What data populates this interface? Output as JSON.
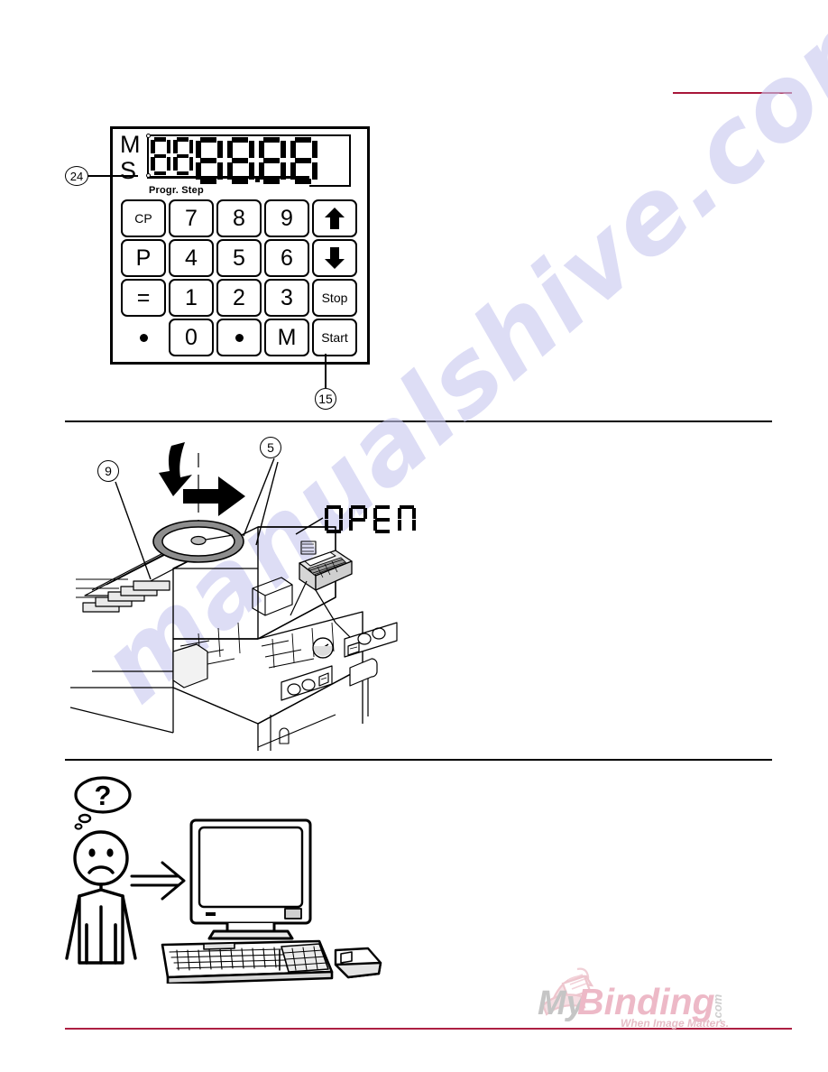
{
  "page": {
    "background": "#ffffff",
    "accent_red": "#a8163a",
    "rule_color": "#000000",
    "watermark": {
      "text": "manualshive.com",
      "color": "#c9c9ef"
    }
  },
  "section_control_panel": {
    "name": "programmable cutter control panel",
    "mode_labels": {
      "metric": "M",
      "inch": "S"
    },
    "display": {
      "type": "seven-segment",
      "small_digits": [
        "8",
        "8"
      ],
      "large_digits": [
        "8",
        "8",
        "8",
        "8"
      ],
      "decimal_point_after_large_index": 1,
      "sub_label": "Progr. Step"
    },
    "keypad": {
      "rows": [
        [
          {
            "label": "CP",
            "kind": "word"
          },
          {
            "label": "7",
            "kind": "digit"
          },
          {
            "label": "8",
            "kind": "digit"
          },
          {
            "label": "9",
            "kind": "digit"
          },
          {
            "label": "",
            "kind": "arrow-up",
            "icon": "arrow-up-icon"
          }
        ],
        [
          {
            "label": "P",
            "kind": "letter"
          },
          {
            "label": "4",
            "kind": "digit"
          },
          {
            "label": "5",
            "kind": "digit"
          },
          {
            "label": "6",
            "kind": "digit"
          },
          {
            "label": "",
            "kind": "arrow-down",
            "icon": "arrow-down-icon"
          }
        ],
        [
          {
            "label": "=",
            "kind": "letter"
          },
          {
            "label": "1",
            "kind": "digit"
          },
          {
            "label": "2",
            "kind": "digit"
          },
          {
            "label": "3",
            "kind": "digit"
          },
          {
            "label": "Stop",
            "kind": "word"
          }
        ],
        [
          {
            "label": "",
            "kind": "blank-dot",
            "icon": "dot-icon"
          },
          {
            "label": "0",
            "kind": "digit"
          },
          {
            "label": "",
            "kind": "dot",
            "icon": "dot-icon"
          },
          {
            "label": "M",
            "kind": "letter"
          },
          {
            "label": "Start",
            "kind": "word"
          }
        ]
      ]
    },
    "callouts": [
      {
        "id": "24",
        "label": "24",
        "points_to": "mode indicator lamps"
      },
      {
        "id": "15",
        "label": "15",
        "points_to": "start button"
      }
    ]
  },
  "section_machine": {
    "name": "paper cutter machine isometric view",
    "display_text": "OPEN",
    "callouts": [
      {
        "id": "9",
        "label": "9",
        "points_to": "paper stack / side table"
      },
      {
        "id": "5",
        "label": "5",
        "points_to": "hand wheel"
      }
    ],
    "annotations": {
      "rotation_arrow": "curved rotation arrow above hand wheel",
      "handwheel_color": "#8a8a8a"
    }
  },
  "section_user": {
    "name": "confused user and computer",
    "thought_bubble": "?",
    "figure_mood": "sad",
    "arrow": "double-line right arrow",
    "computer": "CRT monitor with keyboard and mouse"
  },
  "footer": {
    "logo": {
      "my": "My",
      "binding": "Binding",
      "dotcom": ".com",
      "tagline": "When Image Matters.",
      "gray": "#b9b9b9",
      "pink": "#efc3cd"
    }
  }
}
